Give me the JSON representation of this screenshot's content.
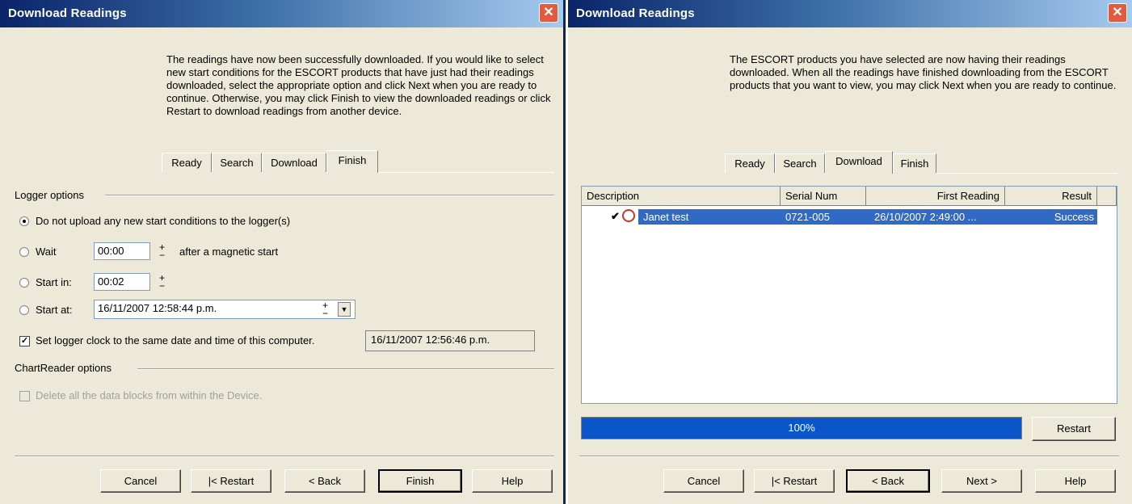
{
  "left_dialog": {
    "title": "Download Readings",
    "close_label": "✕",
    "description": "The readings have now been successfully downloaded. If you would like to select new start conditions for the ESCORT products that have just had their readings downloaded, select the appropriate option and click Next when you are ready to continue. Otherwise, you may click Finish to view the downloaded readings or click Restart to download readings from another device.",
    "tabs": [
      "Ready",
      "Search",
      "Download",
      "Finish"
    ],
    "active_tab": "Finish",
    "logger_options_label": "Logger options",
    "option_no_upload": "Do not upload any new start conditions to the logger(s)",
    "option_wait": "Wait",
    "wait_value": "00:00",
    "wait_suffix": "after a magnetic start",
    "option_start_in": "Start in:",
    "start_in_value": "00:02",
    "option_start_at": "Start at:",
    "start_at_value": "16/11/2007 12:58:44 p.m.",
    "set_clock_label": "Set logger clock to the same date and time of this computer.",
    "computer_time": "16/11/2007  12:56:46 p.m.",
    "chartreader_label": "ChartReader options",
    "delete_blocks_label": "Delete all the data blocks from within the Device.",
    "buttons": {
      "cancel": "Cancel",
      "restart": "|< Restart",
      "back": "< Back",
      "finish": "Finish",
      "help": "Help"
    }
  },
  "right_dialog": {
    "title": "Download Readings",
    "close_label": "✕",
    "description": "The ESCORT products you have selected are now having their readings downloaded. When all the readings have finished downloading from the ESCORT products that you want to view, you may click Next when you are ready to continue.",
    "tabs": [
      "Ready",
      "Search",
      "Download",
      "Finish"
    ],
    "active_tab": "Download",
    "table": {
      "columns": [
        "Description",
        "Serial Num",
        "First Reading",
        "Result"
      ],
      "rows": [
        {
          "description": "Janet test",
          "serial": "0721-005",
          "first_reading": "26/10/2007  2:49:00 ...",
          "result": "Success"
        }
      ]
    },
    "progress": {
      "label": "100%",
      "value": 1.0
    },
    "restart_button": "Restart",
    "buttons": {
      "cancel": "Cancel",
      "restart": "|< Restart",
      "back": "< Back",
      "next": "Next >",
      "help": "Help"
    }
  },
  "colors": {
    "titlebar": "#0a246a",
    "dialog_bg": "#ece9d8",
    "selection": "#316ac5",
    "progress": "#0a56c8"
  }
}
